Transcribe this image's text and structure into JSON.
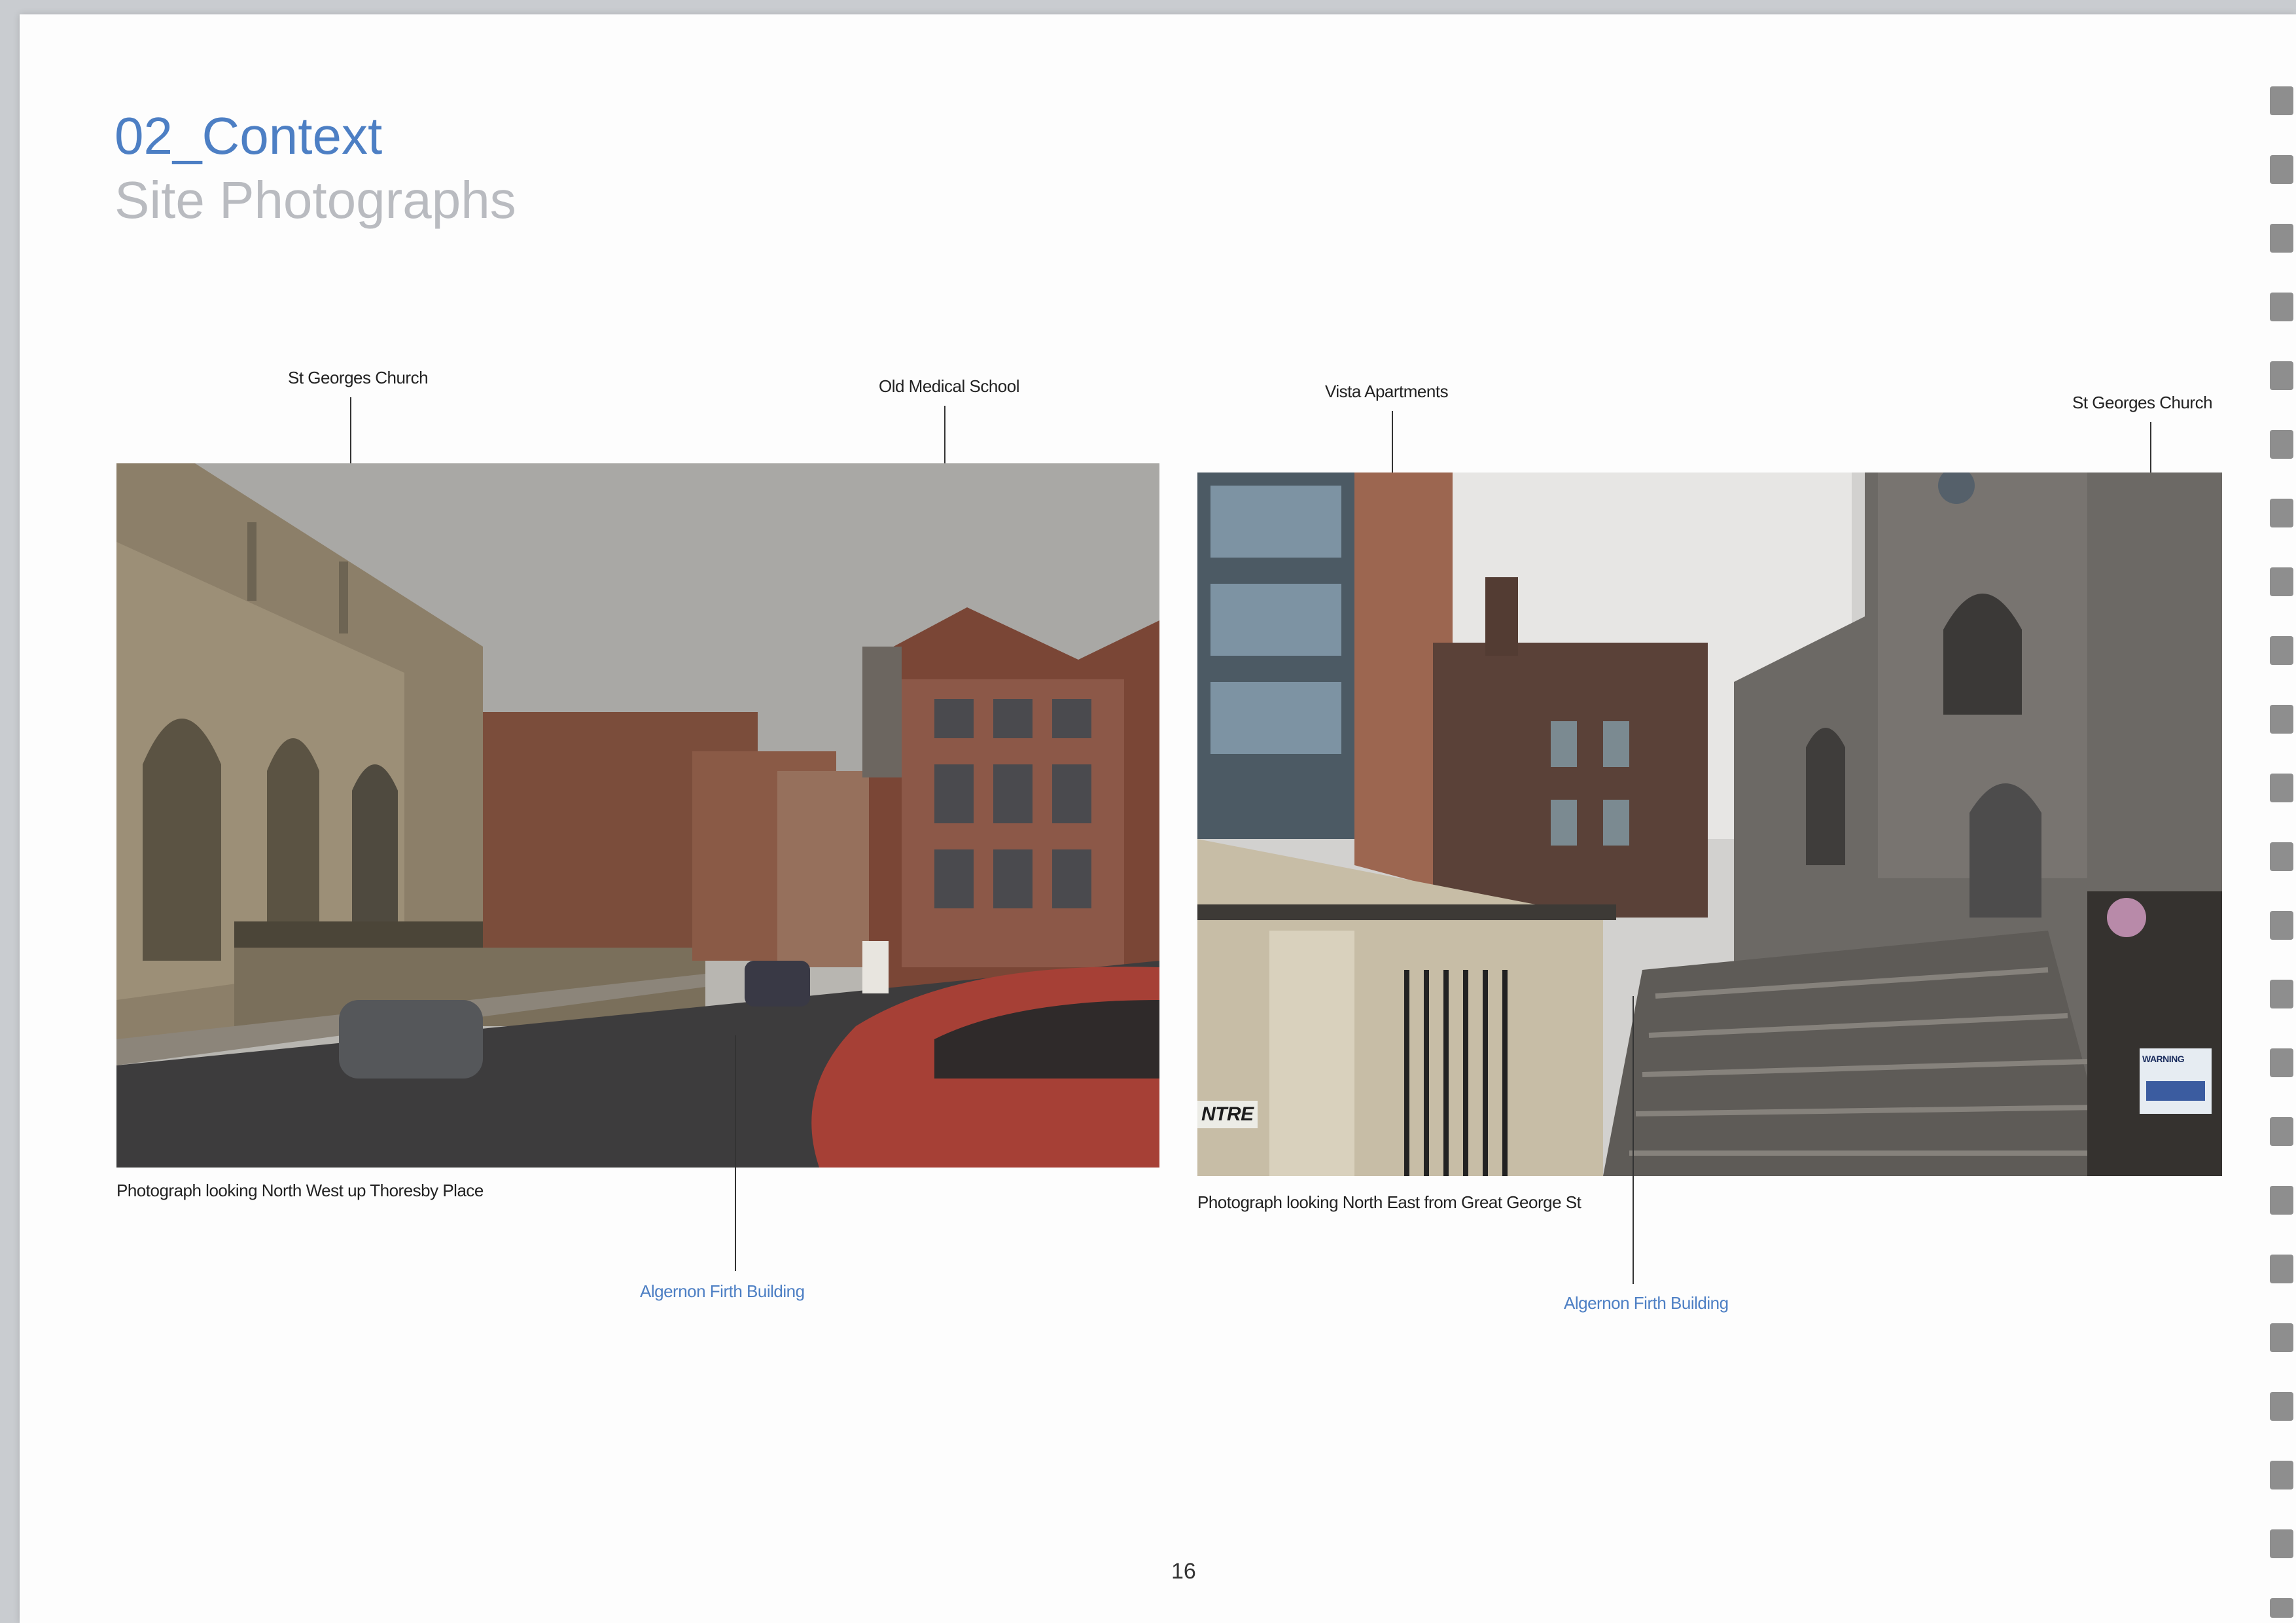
{
  "header": {
    "title": "02_Context",
    "subtitle": "Site Photographs"
  },
  "photos": [
    {
      "caption": "Photograph looking North West up Thoresby Place",
      "labels": {
        "church": "St Georges Church",
        "medical_school": "Old Medical School",
        "algernon": "Algernon Firth Building"
      }
    },
    {
      "caption": "Photograph looking North East from Great George St",
      "labels": {
        "vista": "Vista Apartments",
        "church": "St Georges Church",
        "algernon": "Algernon Firth Building"
      },
      "signs": {
        "entrance": "NTRE",
        "warning": "WARNING"
      }
    }
  ],
  "footer": {
    "page_number": "16"
  },
  "colors": {
    "accent": "#4d7fc4",
    "subtitle": "#b9bbc0"
  }
}
